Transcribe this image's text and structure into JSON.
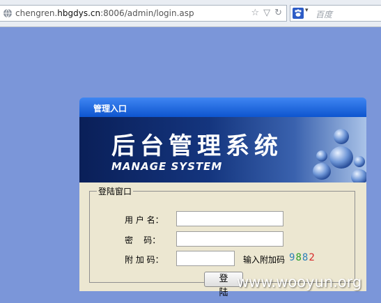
{
  "browser": {
    "url_prefix": "chengren.",
    "url_domain": "hbgdys.cn",
    "url_suffix": ":8006/admin/login.asp",
    "search_placeholder": "百度",
    "star_icon": "star-icon",
    "reload_icon": "reload-icon"
  },
  "panel": {
    "title": "管理入口",
    "banner_cn": "后台管理系统",
    "banner_en": "MANAGE SYSTEM"
  },
  "form": {
    "legend": "登陆窗口",
    "username_label": "用 户 名：",
    "password_label": "密    码：",
    "code_label": "附 加 码：",
    "code_hint": "输入附加码",
    "captcha": [
      "9",
      "8",
      "8",
      "2"
    ],
    "captcha_colors": [
      "#2c7fb8",
      "#2aa02a",
      "#2c7fb8",
      "#d62728"
    ],
    "submit_label": "登 陆"
  },
  "watermark": "www.wooyun.org"
}
